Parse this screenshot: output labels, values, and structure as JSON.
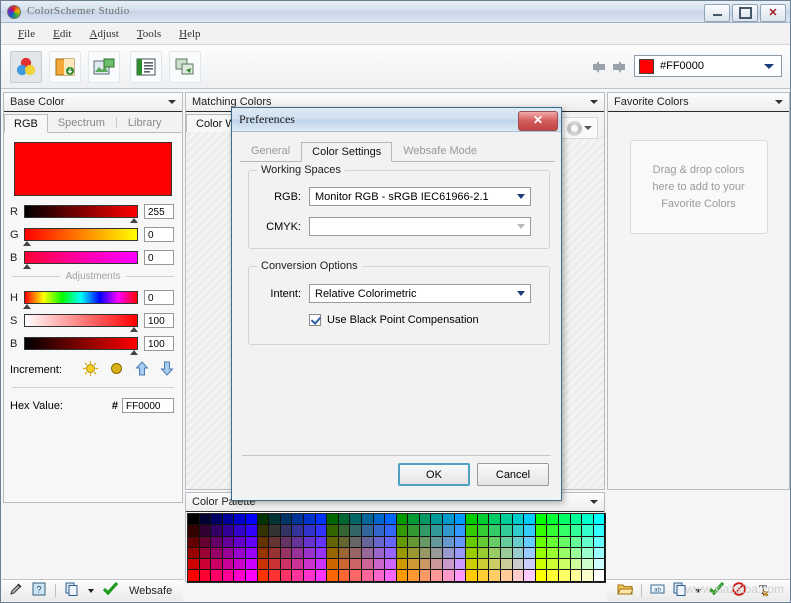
{
  "window": {
    "title": "ColorSchemer Studio",
    "logo_icon": "color-wheel-icon",
    "minimize_label": "",
    "maximize_label": "",
    "close_label": "✕"
  },
  "menubar": {
    "items": [
      {
        "label": "File",
        "accel": "F"
      },
      {
        "label": "Edit",
        "accel": "E"
      },
      {
        "label": "Adjust",
        "accel": "A"
      },
      {
        "label": "Tools",
        "accel": "T"
      },
      {
        "label": "Help",
        "accel": "H"
      }
    ]
  },
  "toolbar": {
    "buttons": [
      {
        "name": "color-schemer-icon",
        "active": true
      },
      {
        "name": "color-gradient-icon",
        "active": false
      },
      {
        "name": "photo-import-icon",
        "active": false
      },
      {
        "name": "library-icon",
        "active": false
      },
      {
        "name": "quick-preview-icon",
        "active": false
      }
    ],
    "nav_back_icon": "arrow-left-icon",
    "nav_forward_icon": "arrow-right-icon",
    "current_color": {
      "hex": "#FF0000",
      "swatch": "#FF0000",
      "dropdown_icon": "chevron-down-icon"
    }
  },
  "base_color_panel": {
    "title": "Base Color",
    "collapse_icon": "chevron-down-icon",
    "tabs": [
      {
        "label": "RGB",
        "active": true
      },
      {
        "label": "Spectrum",
        "active": false
      },
      {
        "label": "Library",
        "active": false
      }
    ],
    "preview_color": "#FF0000",
    "rgb_sliders": [
      {
        "label": "R",
        "value": "255",
        "pos": 97,
        "gradient": "linear-gradient(to right,#000000,#ff0000)"
      },
      {
        "label": "G",
        "value": "0",
        "pos": 2,
        "gradient": "linear-gradient(to right,#ff0000,#ff8000,#ffff00)"
      },
      {
        "label": "B",
        "value": "0",
        "pos": 2,
        "gradient": "linear-gradient(to right,#ff0033,#ff00aa,#ff00ff)"
      }
    ],
    "adjustments_label": "Adjustments",
    "hsb_sliders": [
      {
        "label": "H",
        "value": "0",
        "pos": 2,
        "gradient": "linear-gradient(to right,#ff0000,#ffff00,#00ff00,#00ffff,#0000ff,#ff00ff,#ff0000)"
      },
      {
        "label": "S",
        "value": "100",
        "pos": 97,
        "gradient": "linear-gradient(to right,#ffffff,#ff0000)"
      },
      {
        "label": "B",
        "value": "100",
        "pos": 97,
        "gradient": "linear-gradient(to right,#000000,#ff0000)"
      }
    ],
    "increment_label": "Increment:",
    "increment_icons": [
      "lighten-icon",
      "darken-icon",
      "increase-icon",
      "decrease-icon"
    ],
    "hex_label": "Hex Value:",
    "hex_prefix": "#",
    "hex_value": "FF0000"
  },
  "matching_colors_panel": {
    "title": "Matching Colors",
    "collapse_icon": "chevron-down-icon",
    "tabs": [
      {
        "label": "Color Wheel",
        "active": true
      }
    ],
    "scheme_button_icon": "color-wheel-icon",
    "scheme_dropdown_icon": "chevron-down-icon"
  },
  "favorites_panel": {
    "title": "Favorite Colors",
    "collapse_icon": "chevron-down-icon",
    "dropzone": {
      "line1": "Drag & drop colors",
      "line2": "here to add to your",
      "line3": "Favorite Colors"
    }
  },
  "palette_panel": {
    "title": "Color Palette",
    "collapse_icon": "chevron-down-icon",
    "columns": 36,
    "rows": 6,
    "description": "websafe 216 color grid"
  },
  "status_left": {
    "icons": [
      "eyedropper-icon",
      "help-icon",
      "copy-icon"
    ],
    "copy_dropdown_icon": "chevron-down-icon",
    "check_icon": "check-icon",
    "websafe_label": "Websafe"
  },
  "status_right": {
    "icons": [
      "open-folder-icon",
      "rename-icon",
      "copy-icon"
    ],
    "copy_dropdown_icon": "chevron-down-icon",
    "check_icon": "check-icon",
    "block_icon": "no-entry-icon",
    "text_tool_icon": "text-tool-icon"
  },
  "watermark": {
    "text": "www.xiazaiba.com"
  },
  "preferences_dialog": {
    "title": "Preferences",
    "close_label": "✕",
    "tabs": [
      {
        "label": "General",
        "active": false
      },
      {
        "label": "Color Settings",
        "active": true
      },
      {
        "label": "Websafe Mode",
        "active": false
      }
    ],
    "working_spaces": {
      "legend": "Working Spaces",
      "rgb_label": "RGB:",
      "rgb_value": "Monitor RGB - sRGB IEC61966-2.1",
      "cmyk_label": "CMYK:",
      "cmyk_value": "",
      "dropdown_icon": "chevron-down-icon"
    },
    "conversion_options": {
      "legend": "Conversion Options",
      "intent_label": "Intent:",
      "intent_value": "Relative Colorimetric",
      "dropdown_icon": "chevron-down-icon",
      "blackpoint_label": "Use Black Point Compensation",
      "blackpoint_checked": true
    },
    "ok_label": "OK",
    "cancel_label": "Cancel"
  }
}
